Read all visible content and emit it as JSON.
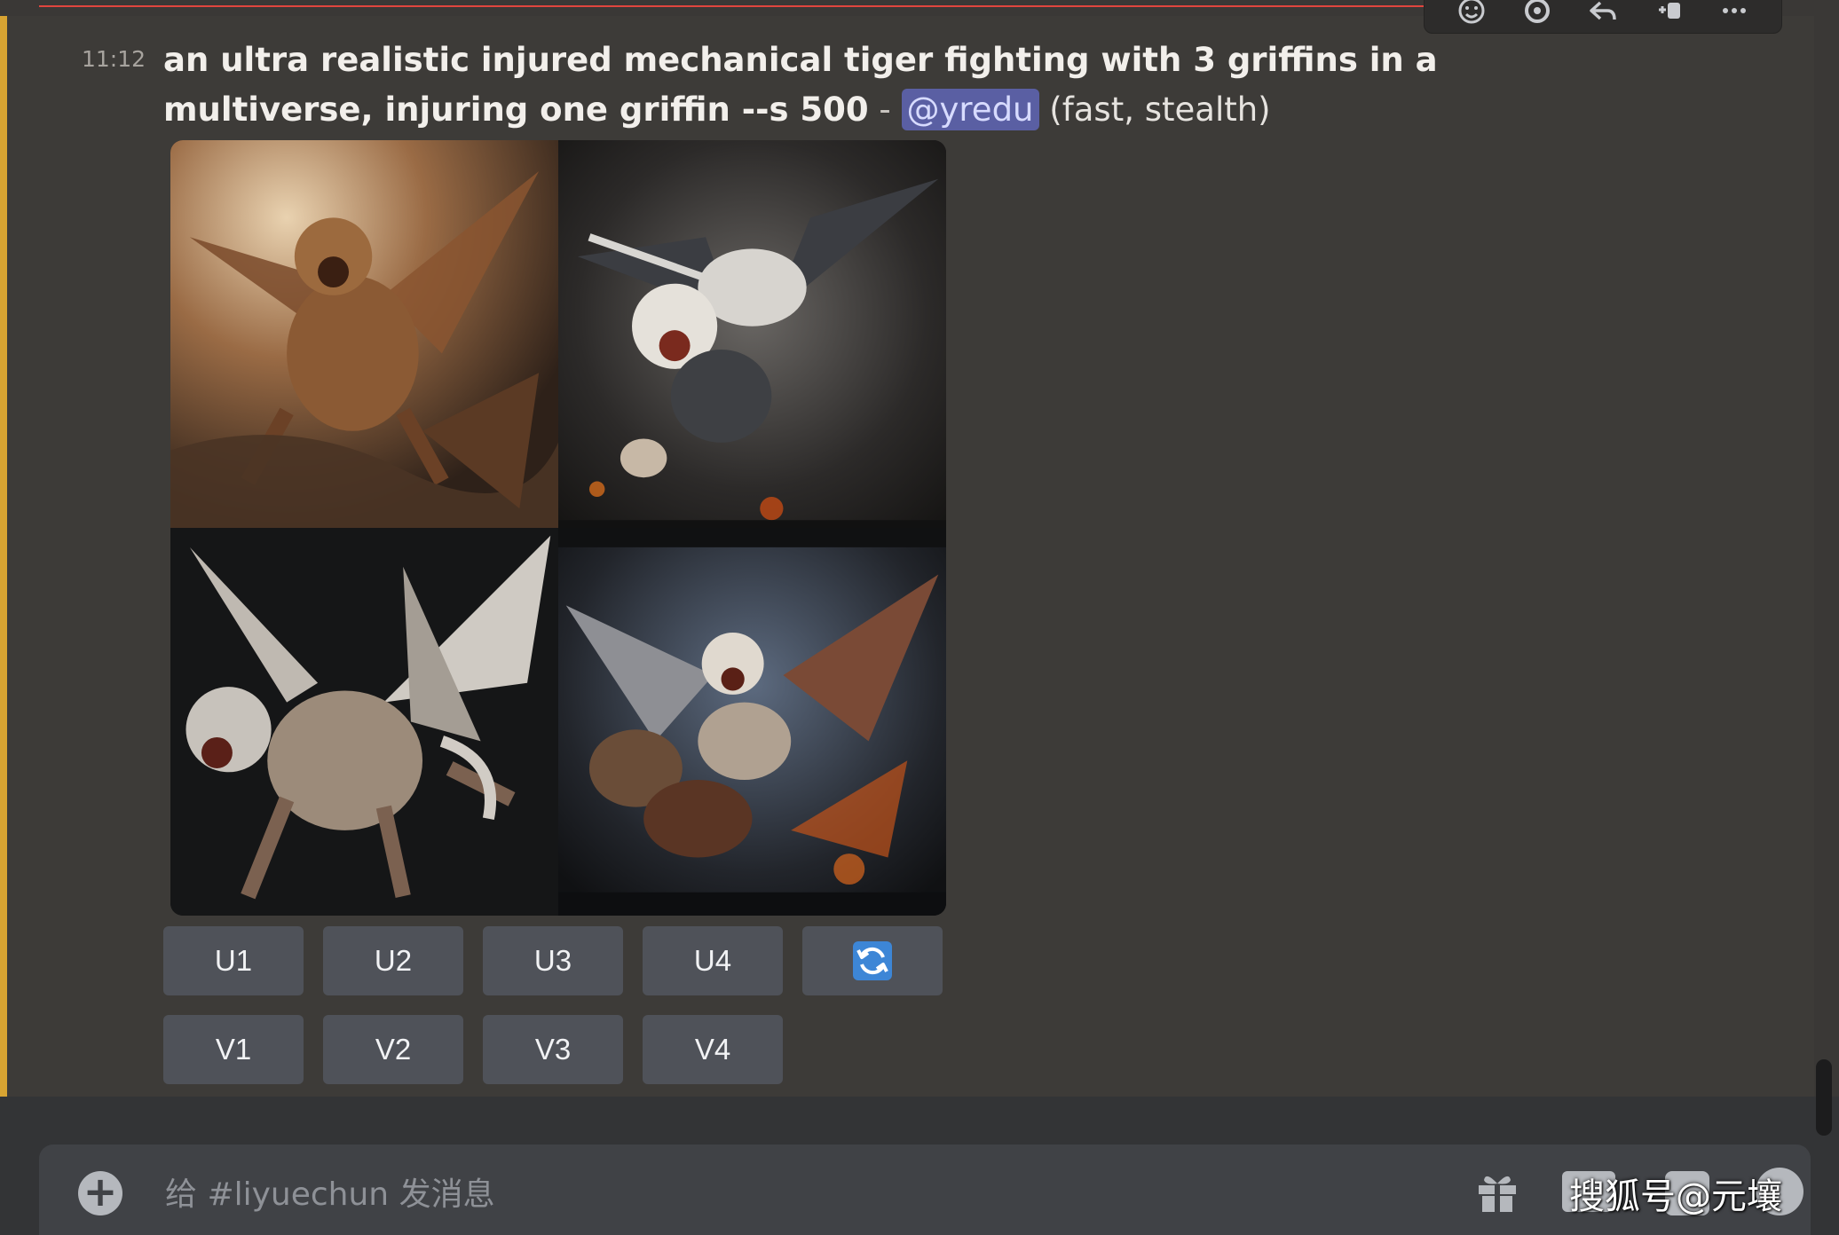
{
  "message": {
    "timestamp": "11:12",
    "prompt": "an ultra realistic injured mechanical tiger fighting with 3 griffins in a multiverse, injuring one griffin --s 500",
    "separator": " - ",
    "mention": "@yredu",
    "mode": " (fast, stealth)"
  },
  "image_grid": {
    "tiles": [
      "upper-left",
      "upper-right",
      "lower-left",
      "lower-right"
    ]
  },
  "buttons": {
    "upscale": [
      "U1",
      "U2",
      "U3",
      "U4"
    ],
    "variation": [
      "V1",
      "V2",
      "V3",
      "V4"
    ],
    "reroll_icon": "refresh-icon"
  },
  "composer": {
    "placeholder": "给 #liyuechun 发消息"
  },
  "watermark": "搜狐号@元壤",
  "colors": {
    "mention_bar": "#d8a432",
    "new_divider": "#e0453e",
    "button_bg": "#4f5259",
    "reroll_blue": "#3d86d6"
  }
}
